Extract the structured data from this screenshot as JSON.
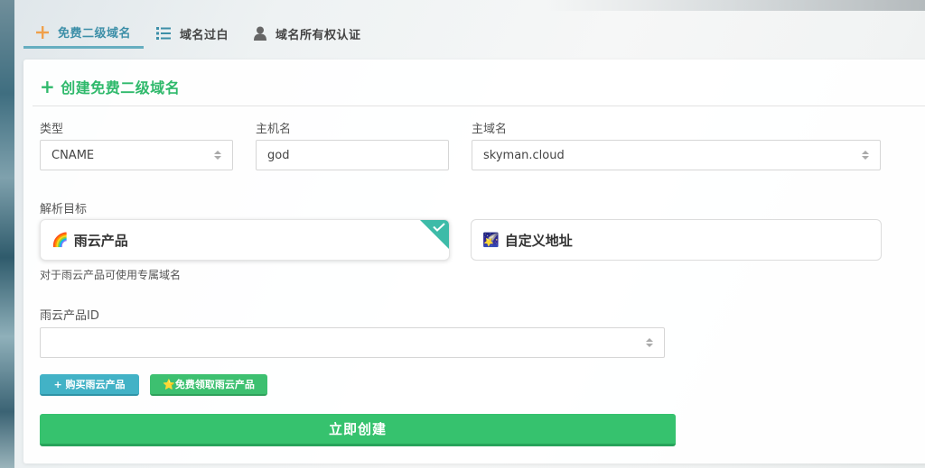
{
  "tabs": [
    {
      "label": "免费二级域名",
      "icon": "plus-icon",
      "active": true
    },
    {
      "label": "域名过白",
      "icon": "list-icon",
      "active": false
    },
    {
      "label": "域名所有权认证",
      "icon": "user-icon",
      "active": false
    }
  ],
  "form": {
    "title": "创建免费二级域名",
    "type_label": "类型",
    "type_value": "CNAME",
    "host_label": "主机名",
    "host_value": "god",
    "domain_label": "主域名",
    "domain_value": "skyman.cloud",
    "target_label": "解析目标",
    "target_options": [
      {
        "label": "雨云产品",
        "icon": "🌈",
        "selected": true
      },
      {
        "label": "自定义地址",
        "icon": "🌠",
        "selected": false
      }
    ],
    "target_hint": "对于雨云产品可使用专属域名",
    "product_id_label": "雨云产品ID",
    "product_id_value": "",
    "buy_button": "+ 购买雨云产品",
    "free_button": "⭐免费领取雨云产品",
    "submit_button": "立即创建"
  },
  "colors": {
    "accent_green": "#36c26e",
    "accent_teal": "#42b2c6",
    "tab_active": "#3d8fa8"
  }
}
